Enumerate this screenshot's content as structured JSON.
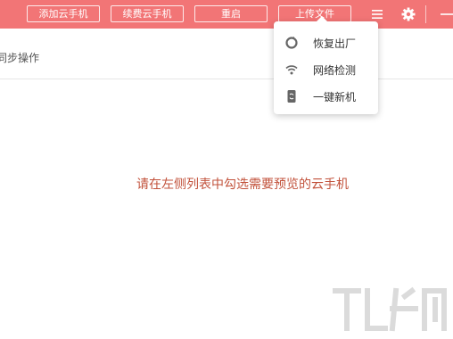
{
  "toolbar": {
    "add_label": "添加云手机",
    "renew_label": "续费云手机",
    "restart_label": "重启",
    "upload_label": "上传文件",
    "menu_icon": "menu-icon",
    "settings_icon": "gear-icon",
    "minimize_icon": "minimize-icon"
  },
  "subbar": {
    "label": "同步操作"
  },
  "dropdown": {
    "items": [
      {
        "label": "恢复出厂",
        "icon": "reset-icon"
      },
      {
        "label": "网络检测",
        "icon": "wifi-icon"
      },
      {
        "label": "一键新机",
        "icon": "new-phone-icon"
      }
    ]
  },
  "main": {
    "message": "请在左侧列表中勾选需要预览的云手机"
  },
  "colors": {
    "topbar": "#f27576",
    "message": "#c2523b"
  }
}
